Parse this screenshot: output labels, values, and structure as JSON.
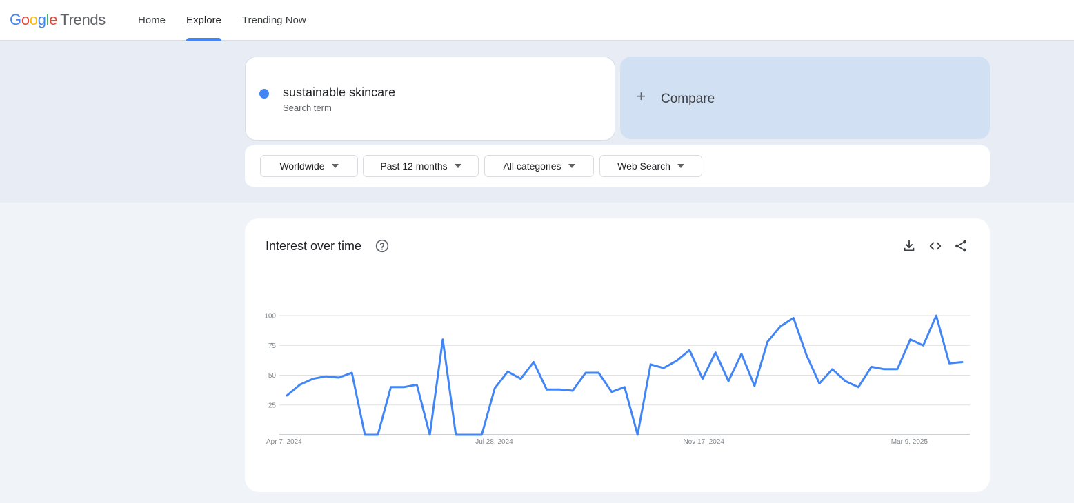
{
  "header": {
    "logo_letters": [
      "G",
      "o",
      "o",
      "g",
      "l",
      "e"
    ],
    "logo_suffix": "Trends",
    "nav": [
      "Home",
      "Explore",
      "Trending Now"
    ],
    "active_nav": "Explore"
  },
  "search": {
    "term": "sustainable skincare",
    "term_type": "Search term",
    "term_color": "#4285f4",
    "compare_label": "Compare"
  },
  "filters": {
    "region": "Worldwide",
    "time": "Past 12 months",
    "category": "All categories",
    "property": "Web Search"
  },
  "panel": {
    "title": "Interest over time",
    "icons": [
      "help-icon",
      "download-icon",
      "embed-icon",
      "share-icon"
    ]
  },
  "chart_data": {
    "type": "line",
    "title": "Interest over time",
    "x_tick_labels": [
      "Apr 7, 2024",
      "Jul 28, 2024",
      "Nov 17, 2024",
      "Mar 9, 2025"
    ],
    "y_ticks": [
      25,
      50,
      75,
      100
    ],
    "ylim": [
      0,
      100
    ],
    "grid": true,
    "series": [
      {
        "color": "#4285f4",
        "x_start": "Apr 7, 2024",
        "x_step": "1 week",
        "values": [
          33,
          42,
          47,
          49,
          48,
          52,
          0,
          0,
          40,
          40,
          42,
          0,
          80,
          0,
          0,
          0,
          39,
          53,
          47,
          61,
          38,
          38,
          37,
          52,
          52,
          36,
          40,
          0,
          59,
          56,
          62,
          71,
          47,
          69,
          45,
          68,
          41,
          78,
          91,
          98,
          67,
          43,
          55,
          45,
          40,
          57,
          55,
          55,
          80,
          75,
          100,
          60,
          61
        ]
      }
    ]
  }
}
